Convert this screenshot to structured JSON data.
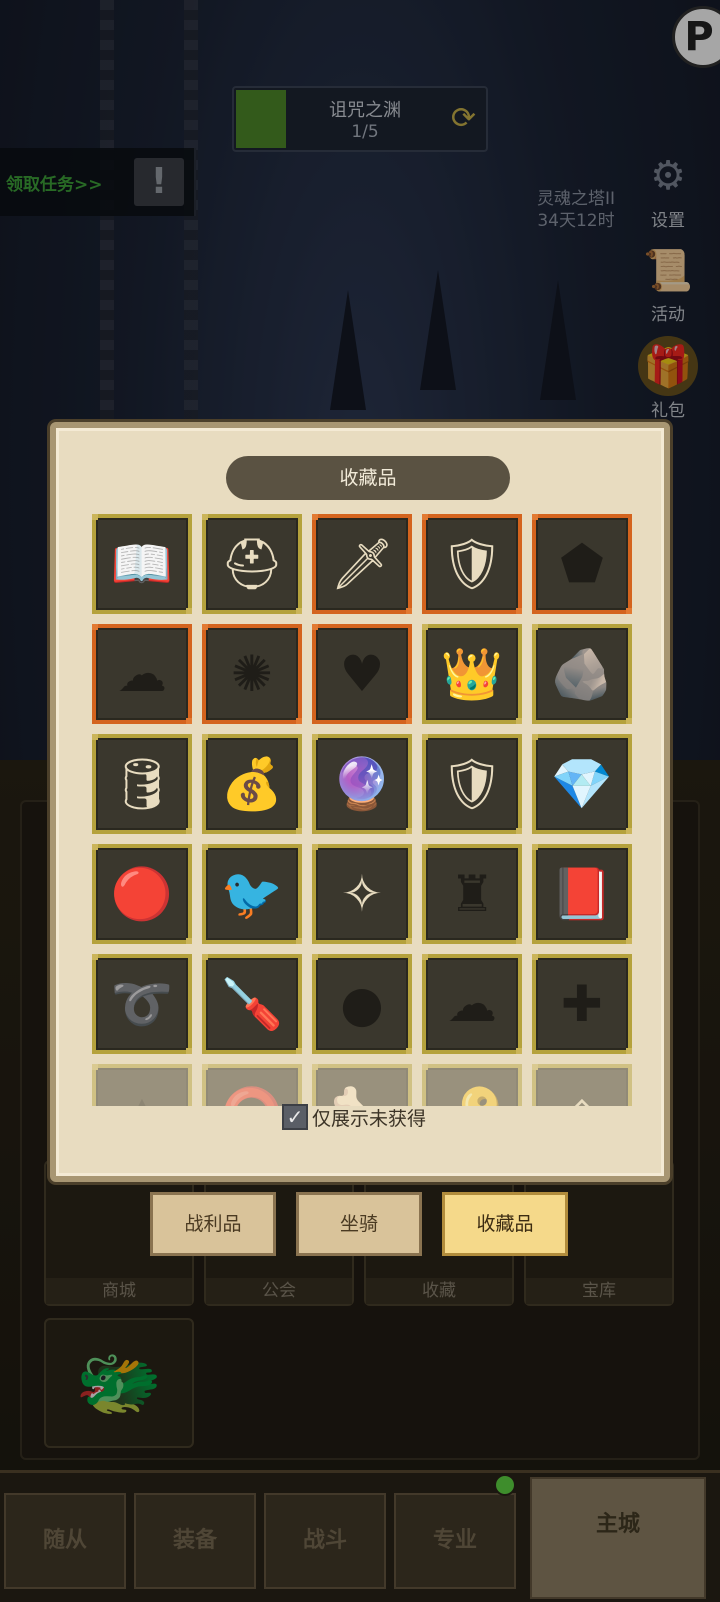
{
  "hud": {
    "progress_name": "诅咒之渊",
    "progress_count": "1/5",
    "progress_fraction": 0.2,
    "quest_label": "领取任务>>",
    "tower_name": "灵魂之塔II",
    "tower_timer": "34天12时",
    "side_buttons": [
      {
        "label": "设置",
        "icon": "gear-icon"
      },
      {
        "label": "活动",
        "icon": "scroll-icon"
      },
      {
        "label": "礼包",
        "icon": "gift-chest-icon"
      }
    ]
  },
  "modal": {
    "title": "收藏品",
    "filter_label": "仅展示未获得",
    "filter_checked": true,
    "items": [
      {
        "icon": "golden-book-icon",
        "glyph": "📖",
        "rarity": "gold",
        "owned": true
      },
      {
        "icon": "golden-helmet-icon",
        "glyph": "⛑",
        "rarity": "gold",
        "owned": true
      },
      {
        "icon": "sword-shield-icon",
        "glyph": "🗡",
        "rarity": "orange",
        "owned": true
      },
      {
        "icon": "armor-crest-icon",
        "glyph": "🛡",
        "rarity": "orange",
        "owned": true
      },
      {
        "icon": "locked-silhouette-icon",
        "glyph": "⬟",
        "rarity": "orange",
        "owned": false
      },
      {
        "icon": "locked-silhouette-icon",
        "glyph": "☁",
        "rarity": "orange",
        "owned": false
      },
      {
        "icon": "locked-silhouette-icon",
        "glyph": "✺",
        "rarity": "orange",
        "owned": false
      },
      {
        "icon": "locked-silhouette-icon",
        "glyph": "♥",
        "rarity": "orange",
        "owned": false
      },
      {
        "icon": "royal-crown-icon",
        "glyph": "👑",
        "rarity": "gold",
        "owned": true
      },
      {
        "icon": "rune-tablet-icon",
        "glyph": "🪨",
        "rarity": "gold",
        "owned": true
      },
      {
        "icon": "drum-barrel-icon",
        "glyph": "🛢",
        "rarity": "gold",
        "owned": true
      },
      {
        "icon": "purple-pouch-icon",
        "glyph": "💰",
        "rarity": "gold",
        "owned": true
      },
      {
        "icon": "crystal-orb-icon",
        "glyph": "🔮",
        "rarity": "gold",
        "owned": true
      },
      {
        "icon": "dark-shield-icon",
        "glyph": "🛡",
        "rarity": "gold",
        "owned": true
      },
      {
        "icon": "ice-crystal-icon",
        "glyph": "💎",
        "rarity": "gold",
        "owned": true
      },
      {
        "icon": "red-gem-armor-icon",
        "glyph": "🔴",
        "rarity": "gold",
        "owned": true
      },
      {
        "icon": "wooden-bird-icon",
        "glyph": "🐦",
        "rarity": "gold",
        "owned": true
      },
      {
        "icon": "teal-emblem-icon",
        "glyph": "✧",
        "rarity": "gold",
        "owned": true
      },
      {
        "icon": "locked-silhouette-icon",
        "glyph": "♜",
        "rarity": "gold",
        "owned": false
      },
      {
        "icon": "leather-tome-icon",
        "glyph": "📕",
        "rarity": "gold",
        "owned": true
      },
      {
        "icon": "golden-hook-icon",
        "glyph": "➰",
        "rarity": "gold",
        "owned": true
      },
      {
        "icon": "screwdriver-icon",
        "glyph": "🪛",
        "rarity": "gold",
        "owned": true
      },
      {
        "icon": "locked-silhouette-icon",
        "glyph": "●",
        "rarity": "gold",
        "owned": false
      },
      {
        "icon": "locked-silhouette-icon",
        "glyph": "☁",
        "rarity": "gold",
        "owned": false
      },
      {
        "icon": "locked-silhouette-icon",
        "glyph": "✚",
        "rarity": "gold",
        "owned": false
      },
      {
        "icon": "locked-silhouette-icon",
        "glyph": "▲",
        "rarity": "gold",
        "owned": false
      },
      {
        "icon": "ruby-amulet-icon",
        "glyph": "⭕",
        "rarity": "gold",
        "owned": true
      },
      {
        "icon": "scroll-bone-icon",
        "glyph": "🦴",
        "rarity": "gold",
        "owned": true
      },
      {
        "icon": "golden-key-icon",
        "glyph": "🔑",
        "rarity": "gold",
        "owned": true
      },
      {
        "icon": "stone-rune-icon",
        "glyph": "◈",
        "rarity": "gold",
        "owned": true
      }
    ]
  },
  "tabs": [
    {
      "label": "战利品",
      "active": false
    },
    {
      "label": "坐骑",
      "active": false
    },
    {
      "label": "收藏品",
      "active": true
    }
  ],
  "buildings": [
    "商城",
    "公会",
    "收藏",
    "宝库"
  ],
  "nav": [
    "随从",
    "装备",
    "战斗",
    "专业",
    "主城"
  ],
  "colors": {
    "gold_frame": "#b5a23c",
    "orange_frame": "#d4641e",
    "parchment": "#e8dcc0"
  }
}
